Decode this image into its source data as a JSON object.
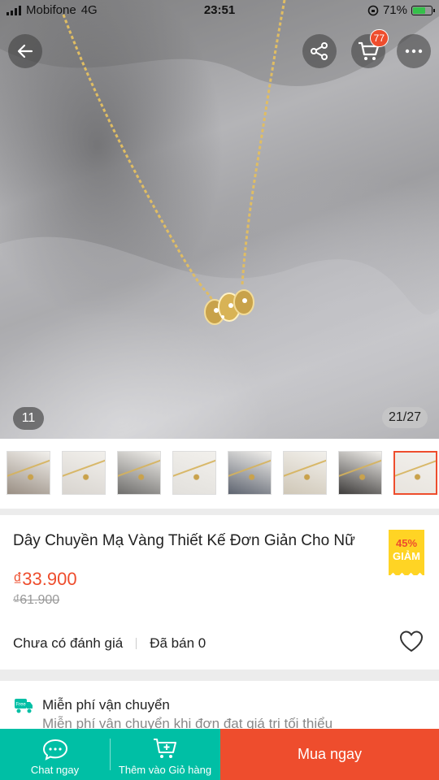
{
  "status_bar": {
    "carrier": "Mobifone",
    "network": "4G",
    "time": "23:51",
    "battery_percent": "71%",
    "battery_level": 0.71
  },
  "gallery": {
    "badge_count": "77",
    "image_counter_left": "11",
    "image_counter": "21/27",
    "thumbnail_count": 9,
    "active_thumbnail_index": 7
  },
  "product": {
    "title": "Dây Chuyền Mạ Vàng Thiết Kế Đơn Giản Cho Nữ",
    "discount_percent": "45%",
    "discount_label": "GIẢM",
    "price": "₫33.900",
    "original_price": "₫61.900",
    "rating_text": "Chưa có đánh giá",
    "sold_text": "Đã bán 0"
  },
  "shipping": {
    "icon_text": "Free",
    "title": "Miễn phí vận chuyển",
    "subtitle": "Miễn phí vận chuyển khi đơn đạt giá trị tối thiểu"
  },
  "bottom_bar": {
    "chat_label": "Chat ngay",
    "cart_label": "Thêm vào Giỏ hàng",
    "buy_label": "Mua ngay"
  },
  "colors": {
    "brand": "#ee4d2d",
    "teal": "#00bfa5",
    "discount_badge": "#ffd424"
  }
}
